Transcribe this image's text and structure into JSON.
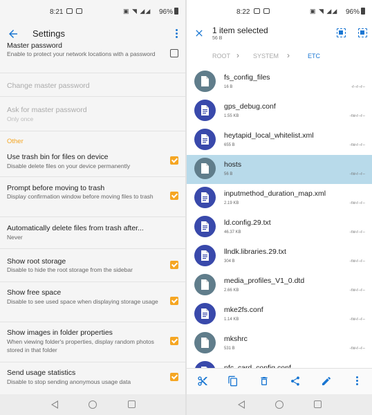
{
  "left": {
    "status": {
      "time": "8:21",
      "battery": "96%"
    },
    "title": "Settings",
    "prefs": [
      {
        "title": "Master password",
        "summary": "Enable to protect your network locations with a password",
        "checkbox": "off"
      },
      {
        "title": "Change master password",
        "summary": "",
        "disabled": true
      },
      {
        "title": "Ask for master password",
        "summary": "Only once",
        "disabled": true
      },
      {
        "title": "Use trash bin for files on device",
        "summary": "Disable delete files on your device permanently",
        "checkbox": "on"
      },
      {
        "title": "Prompt before moving to trash",
        "summary": "Display confirmation window before moving files to trash",
        "checkbox": "on"
      },
      {
        "title": "Automatically delete files from trash after...",
        "summary": "Never"
      },
      {
        "title": "Show root storage",
        "summary": "Disable to hide the root storage from the sidebar",
        "checkbox": "on"
      },
      {
        "title": "Show free space",
        "summary": "Disable to see used space when displaying storage usage",
        "checkbox": "on"
      },
      {
        "title": "Show images in folder properties",
        "summary": "When viewing folder's properties, display random photos stored in that folder",
        "checkbox": "on"
      },
      {
        "title": "Send usage statistics",
        "summary": "Disable to stop sending anonymous usage data",
        "checkbox": "on"
      }
    ],
    "section_other": "Other"
  },
  "right": {
    "status": {
      "time": "8:22",
      "battery": "96%"
    },
    "selection_title": "1 item selected",
    "selection_size": "56 B",
    "breadcrumb": [
      "ROOT",
      "SYSTEM",
      "ETC"
    ],
    "files": [
      {
        "name": "fs_config_files",
        "size": "16 B",
        "perm": "-r--r--r--",
        "type": "file"
      },
      {
        "name": "gps_debug.conf",
        "size": "1.55 KB",
        "perm": "-rw-r--r--",
        "type": "doc"
      },
      {
        "name": "heytapid_local_whitelist.xml",
        "size": "655 B",
        "perm": "-rw-r--r--",
        "type": "doc"
      },
      {
        "name": "hosts",
        "size": "56 B",
        "perm": "-rw-r--r--",
        "type": "file",
        "selected": true
      },
      {
        "name": "inputmethod_duration_map.xml",
        "size": "2.19 KB",
        "perm": "-rw-r--r--",
        "type": "doc"
      },
      {
        "name": "ld.config.29.txt",
        "size": "46.37 KB",
        "perm": "-rw-r--r--",
        "type": "doc"
      },
      {
        "name": "llndk.libraries.29.txt",
        "size": "304 B",
        "perm": "-rw-r--r--",
        "type": "doc"
      },
      {
        "name": "media_profiles_V1_0.dtd",
        "size": "2.66 KB",
        "perm": "-rw-r--r--",
        "type": "file"
      },
      {
        "name": "mke2fs.conf",
        "size": "1.14 KB",
        "perm": "-rw-r--r--",
        "type": "doc"
      },
      {
        "name": "mkshrc",
        "size": "531 B",
        "perm": "-rw-r--r--",
        "type": "file"
      },
      {
        "name": "nfc_card_config.conf",
        "size": "",
        "perm": "",
        "type": "doc"
      }
    ],
    "actions": [
      "cut-icon",
      "copy-icon",
      "delete-icon",
      "share-icon",
      "edit-icon",
      "more-icon"
    ]
  },
  "colors": {
    "accent": "#1976d2",
    "checkbox": "#f5a623",
    "doc_icon": "#3949ab",
    "file_icon": "#607d8b",
    "selected_row": "#b8daea"
  }
}
